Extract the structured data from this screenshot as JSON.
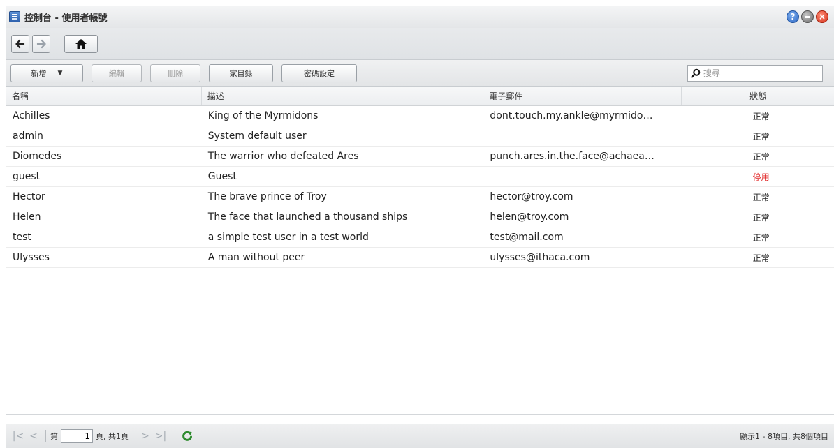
{
  "window": {
    "title": "控制台 - 使用者帳號",
    "controls": {
      "help": "?",
      "close": "×"
    }
  },
  "toolbar": {
    "add": "新增",
    "edit": "編輯",
    "delete": "刪除",
    "home_folder": "家目錄",
    "password_settings": "密碼設定",
    "search_placeholder": "搜尋"
  },
  "table": {
    "columns": [
      "名稱",
      "描述",
      "電子郵件",
      "狀態"
    ],
    "rows": [
      {
        "name": "Achilles",
        "description": "King of the Myrmidons",
        "email": "dont.touch.my.ankle@myrmido…",
        "status": "正常"
      },
      {
        "name": "admin",
        "description": "System default user",
        "email": "",
        "status": "正常"
      },
      {
        "name": "Diomedes",
        "description": "The warrior who defeated Ares",
        "email": "punch.ares.in.the.face@achaea…",
        "status": "正常"
      },
      {
        "name": "guest",
        "description": "Guest",
        "email": "",
        "status": "停用"
      },
      {
        "name": "Hector",
        "description": "The brave prince of Troy",
        "email": "hector@troy.com",
        "status": "正常"
      },
      {
        "name": "Helen",
        "description": "The face that launched a thousand ships",
        "email": "helen@troy.com",
        "status": "正常"
      },
      {
        "name": "test",
        "description": "a simple test user in a test world",
        "email": "test@mail.com",
        "status": "正常"
      },
      {
        "name": "Ulysses",
        "description": "A man without peer",
        "email": "ulysses@ithaca.com",
        "status": "正常"
      }
    ]
  },
  "footer": {
    "page_prefix": "第",
    "page_value": "1",
    "page_suffix": "頁, 共1頁",
    "display_info": "顯示1 - 8項目, 共8個項目",
    "first": "|<",
    "prev": "<",
    "next": ">",
    "last": ">|"
  },
  "colors": {
    "disabled_status": "#e02020",
    "refresh": "#2e8b2e"
  }
}
